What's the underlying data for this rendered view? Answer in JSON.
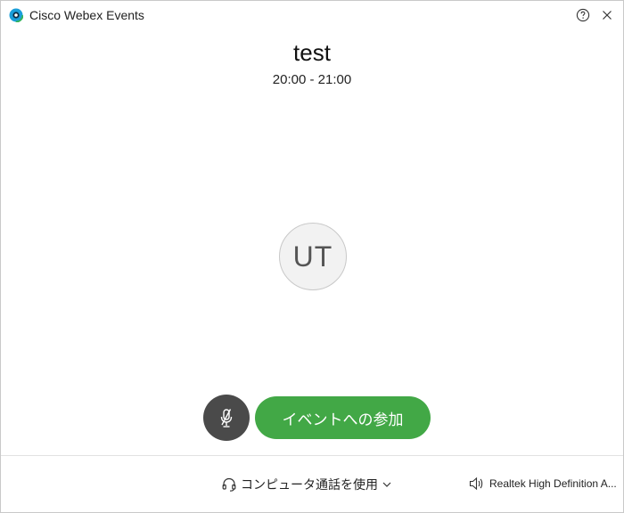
{
  "window": {
    "app_title": "Cisco Webex Events"
  },
  "event": {
    "title": "test",
    "time": "20:00 - 21:00"
  },
  "user": {
    "initials": "UT"
  },
  "controls": {
    "join_label": "イベントへの参加"
  },
  "audio": {
    "connection_label": "コンピュータ通話を使用",
    "speaker_label": "Realtek High Definition A..."
  },
  "colors": {
    "join_button": "#42a846",
    "mute_button": "#4a4a4a"
  }
}
